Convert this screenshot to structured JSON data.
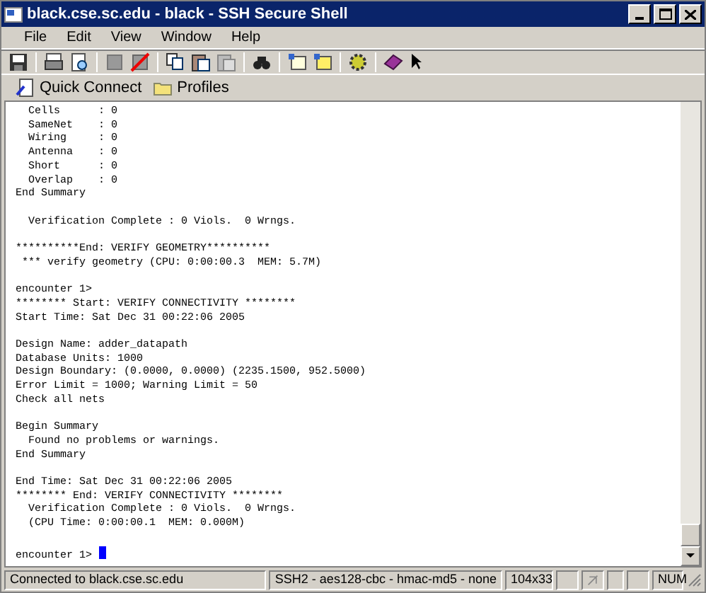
{
  "window": {
    "title": "black.cse.sc.edu - black - SSH Secure Shell"
  },
  "menu": [
    "File",
    "Edit",
    "View",
    "Window",
    "Help"
  ],
  "quick_toolbar": [
    {
      "kind": "connect",
      "label": "Quick Connect"
    },
    {
      "kind": "folder",
      "label": "Profiles"
    }
  ],
  "terminal": {
    "blocks": [
      [
        "  Cells      : 0",
        "  SameNet    : 0",
        "  Wiring     : 0",
        "  Antenna    : 0",
        "  Short      : 0",
        "  Overlap    : 0",
        "End Summary"
      ],
      [
        "  Verification Complete : 0 Viols.  0 Wrngs."
      ],
      [
        "**********End: VERIFY GEOMETRY**********",
        " *** verify geometry (CPU: 0:00:00.3  MEM: 5.7M)"
      ],
      [
        "encounter 1>",
        "******** Start: VERIFY CONNECTIVITY ********",
        "Start Time: Sat Dec 31 00:22:06 2005"
      ],
      [
        "Design Name: adder_datapath",
        "Database Units: 1000",
        "Design Boundary: (0.0000, 0.0000) (2235.1500, 952.5000)",
        "Error Limit = 1000; Warning Limit = 50",
        "Check all nets"
      ],
      [
        "Begin Summary",
        "  Found no problems or warnings.",
        "End Summary"
      ],
      [
        "End Time: Sat Dec 31 00:22:06 2005",
        "******** End: VERIFY CONNECTIVITY ********",
        "  Verification Complete : 0 Viols.  0 Wrngs.",
        "  (CPU Time: 0:00:00.1  MEM: 0.000M)"
      ],
      [
        "encounter 1> "
      ]
    ]
  },
  "status_bar": {
    "connection": "Connected to black.cse.sc.edu",
    "cipher": "SSH2 - aes128-cbc - hmac-md5 - none",
    "size": "104x33",
    "num": "NUM"
  }
}
